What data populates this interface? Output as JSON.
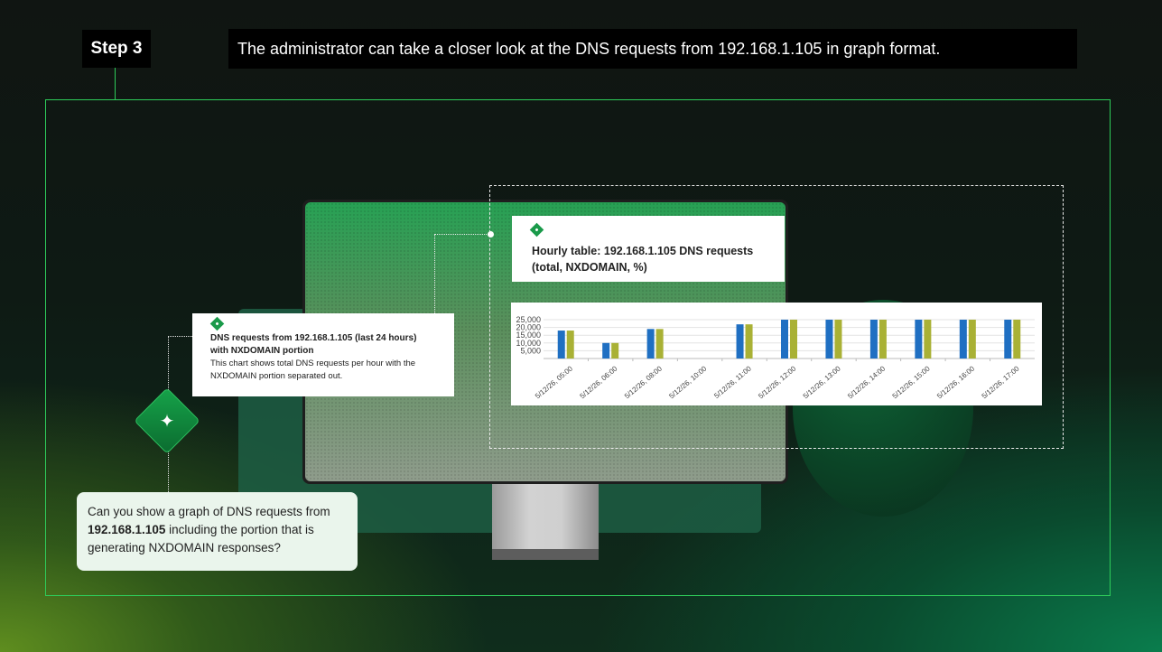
{
  "header": {
    "step_label": "Step 3",
    "description": "The administrator can take a closer look at the DNS requests from 192.168.1.105 in graph format."
  },
  "hourly_card": {
    "title": "Hourly table: 192.168.1.105  DNS requests (total, NXDOMAIN, %)"
  },
  "dns_card": {
    "title": "DNS requests from 192.168.1.105 (last 24 hours) with NXDOMAIN portion",
    "description": "This chart shows total DNS requests per hour with the NXDOMAIN portion separated out."
  },
  "prompt": {
    "line_pre": "Can you show a graph of DNS requests from",
    "ip": "192.168.1.105",
    "line_post": " including the portion that is generating NXDOMAIN responses?"
  },
  "icons": {
    "card_icon": "diamond-dots-icon",
    "assistant_icon": "sparkle-icon"
  },
  "colors": {
    "accent_green": "#2ecc5a",
    "series_total": "#1f6fc2",
    "series_nxdomain": "#a9b135"
  },
  "chart_data": {
    "type": "bar",
    "categories": [
      "5/12/26, 05:00",
      "5/12/26, 06:00",
      "5/12/26, 08:00",
      "5/12/26, 10:00",
      "5/12/26, 11:00",
      "5/12/26, 12:00",
      "5/12/26, 13:00",
      "5/12/26, 14:00",
      "5/12/26, 15:00",
      "5/12/26, 16:00",
      "5/12/26, 17:00"
    ],
    "series": [
      {
        "values": [
          18000,
          10000,
          19000,
          0,
          22000,
          25000,
          25000,
          25000,
          25000,
          25000,
          25000
        ]
      },
      {
        "values": [
          18000,
          10000,
          19000,
          0,
          22000,
          25000,
          25000,
          25000,
          25000,
          25000,
          25000
        ]
      }
    ],
    "yticks": [
      "25,000",
      "20,000",
      "15,000",
      "10,000",
      "5,000"
    ],
    "ylim": [
      0,
      25000
    ],
    "grid": true
  }
}
